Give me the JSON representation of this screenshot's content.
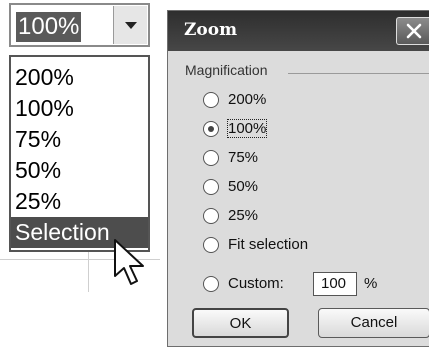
{
  "zoom_combo": {
    "value": "100%",
    "options": [
      "200%",
      "100%",
      "75%",
      "50%",
      "25%",
      "Selection"
    ],
    "highlighted": "Selection"
  },
  "dialog": {
    "title": "Zoom",
    "group_label": "Magnification",
    "options": [
      {
        "label": "200%",
        "checked": false
      },
      {
        "label": "100%",
        "checked": true
      },
      {
        "label": "75%",
        "checked": false
      },
      {
        "label": "50%",
        "checked": false
      },
      {
        "label": "25%",
        "checked": false
      },
      {
        "label": "Fit selection",
        "checked": false
      },
      {
        "label": "Custom:",
        "checked": false
      }
    ],
    "custom_value": "100",
    "percent_sign": "%",
    "ok_label": "OK",
    "cancel_label": "Cancel"
  }
}
